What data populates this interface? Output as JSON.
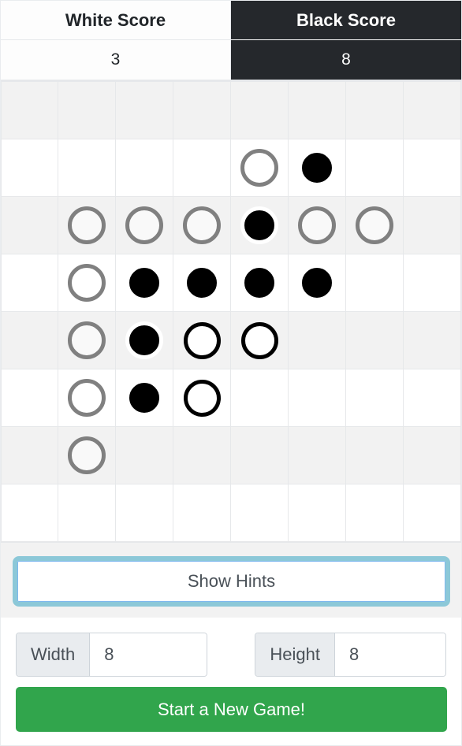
{
  "scores": {
    "white_label": "White Score",
    "black_label": "Black Score",
    "white_value": "3",
    "black_value": "8"
  },
  "board": {
    "width": 8,
    "height": 8,
    "legend": {
      "B": "black-piece",
      "W": "white-piece",
      "h": "hint-move",
      ".": "empty"
    },
    "rows": [
      "........",
      "....hB..",
      ".hhhBhh.",
      ".hBBBB..",
      ".hBWW...",
      ".hBW....",
      ".h......",
      "........"
    ]
  },
  "hints_button": {
    "label": "Show Hints"
  },
  "settings": {
    "width_label": "Width",
    "width_value": "8",
    "height_label": "Height",
    "height_value": "8"
  },
  "new_game_button": {
    "label": "Start a New Game!"
  },
  "colors": {
    "black_panel": "#25282c",
    "new_game_green": "#31a54c",
    "hint_ring": "#808080",
    "focus_ring": "#8cc8d8"
  }
}
